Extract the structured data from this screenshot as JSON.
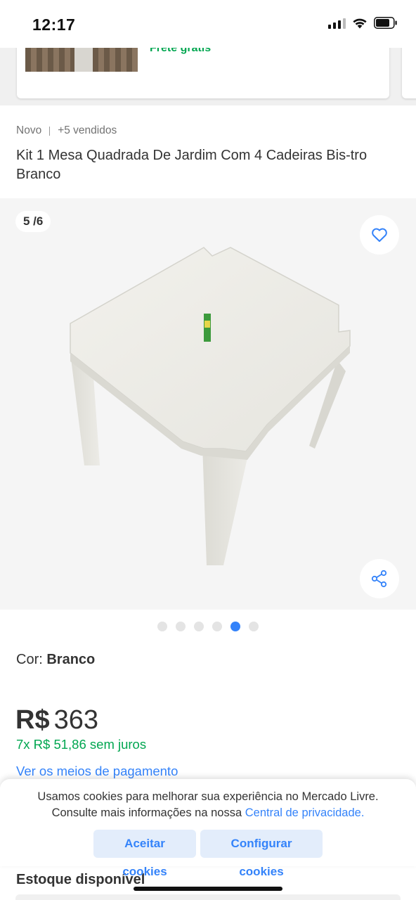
{
  "status_bar": {
    "time": "12:17"
  },
  "previous_card": {
    "shipping": "Frete grátis"
  },
  "product": {
    "condition": "Novo",
    "sold": "+5 vendidos",
    "title": "Kit 1 Mesa Quadrada De Jardim Com 4 Cadeiras Bis-tro Branco",
    "gallery": {
      "counter": "5 /6",
      "total_images": 6,
      "active_index": 5,
      "favorite_icon": "heart-outline-icon",
      "share_icon": "share-icon"
    },
    "color_label": "Cor:",
    "color_value": "Branco",
    "price_currency": "R$",
    "price_amount": "363",
    "installments": "7x R$ 51,86 sem juros",
    "payment_link": "Ver os meios de pagamento",
    "stock_heading": "Estoque disponível"
  },
  "cookie_banner": {
    "line1": "Usamos cookies para melhorar sua experiência no Mercado Livre.",
    "line2_prefix": "Consulte mais informações na nossa",
    "privacy_link": "Central de privacidade.",
    "accept_label": "Aceitar cookies",
    "configure_label": "Configurar cookies"
  },
  "colors": {
    "accent_blue": "#3483fa",
    "success_green": "#00a650",
    "button_bg": "#e3edfb"
  }
}
